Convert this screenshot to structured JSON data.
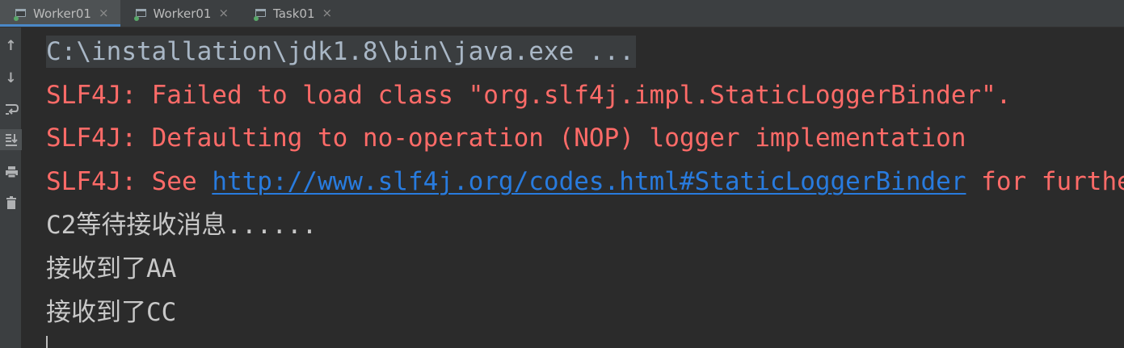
{
  "tabs": [
    {
      "label": "Worker01",
      "icon": "run-console-icon",
      "close": "×",
      "active": true
    },
    {
      "label": "Worker01",
      "icon": "run-console-icon",
      "close": "×",
      "active": false
    },
    {
      "label": "Task01",
      "icon": "run-console-icon",
      "close": "×",
      "active": false
    }
  ],
  "toolbar": [
    {
      "name": "scroll-up-icon",
      "glyph": "↑"
    },
    {
      "name": "scroll-down-icon",
      "glyph": "↓"
    },
    {
      "name": "soft-wrap-icon",
      "glyph": "soft-wrap"
    },
    {
      "name": "scroll-to-end-icon",
      "glyph": "scroll-to-end",
      "selected": true
    },
    {
      "name": "print-icon",
      "glyph": "print"
    },
    {
      "name": "clear-all-icon",
      "glyph": "trash"
    }
  ],
  "console": {
    "command": "C:\\installation\\jdk1.8\\bin\\java.exe ...",
    "err1": "SLF4J: Failed to load class \"org.slf4j.impl.StaticLoggerBinder\".",
    "err2": "SLF4J: Defaulting to no-operation (NOP) logger implementation",
    "err3_prefix": "SLF4J: See ",
    "err3_link": "http://www.slf4j.org/codes.html#StaticLoggerBinder",
    "err3_suffix": " for further details.",
    "out1": "C2等待接收消息......",
    "out2": "接收到了AA",
    "out3": "接收到了CC"
  },
  "colors": {
    "background": "#2b2b2b",
    "error": "#ff6b68",
    "link": "#287bde",
    "stdout": "#c8c8c8",
    "command": "#a9b7c6",
    "run_indicator": "#59a869"
  }
}
